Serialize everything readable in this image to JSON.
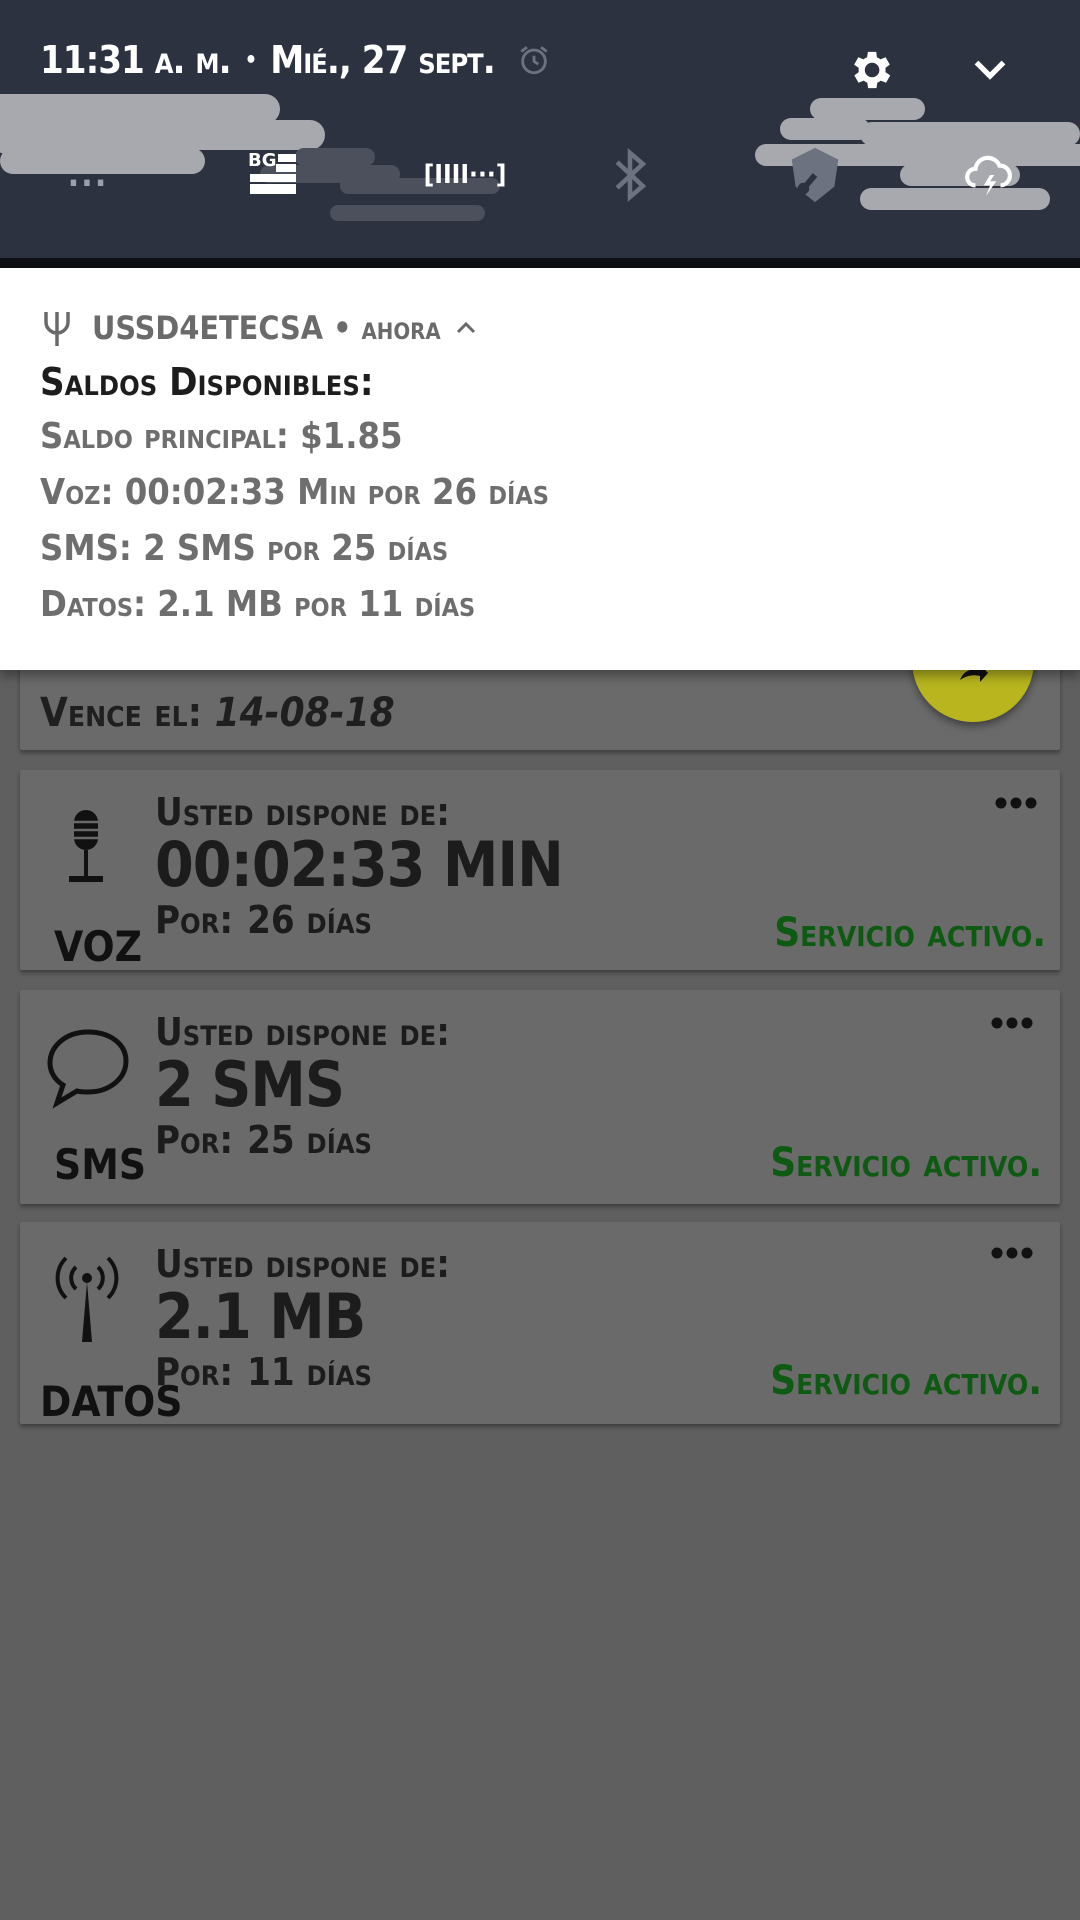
{
  "status_bar": {
    "time": "11:31 a. m.",
    "separator": "•",
    "date": "Mié., 27 sept."
  },
  "quick_tiles": {
    "overflow": "...",
    "battery_tile": "[IIII···]"
  },
  "notification": {
    "app_name": "USSD4ETECSA",
    "separator": "•",
    "time": "ahora",
    "title": "Saldos Disponibles:",
    "lines": [
      "Saldo principal: $1.85",
      "Voz: 00:02:33 Min por 26 días",
      "SMS: 2 SMS por 25 días",
      "Datos: 2.1 MB por 11 días"
    ]
  },
  "balance_card": {
    "expiry_label": "Vence el:",
    "expiry_date": "14-08-18"
  },
  "services": [
    {
      "name": "VOZ",
      "icon": "microphone-icon",
      "caption": "Usted dispone de:",
      "amount": "00:02:33 MIN",
      "period_label": "Por:",
      "period_value": "26 días",
      "status": "Servicio activo."
    },
    {
      "name": "SMS",
      "icon": "speech-bubble-icon",
      "caption": "Usted dispone de:",
      "amount": "2 SMS",
      "period_label": "Por:",
      "period_value": "25 días",
      "status": "Servicio activo."
    },
    {
      "name": "DATOS",
      "icon": "antenna-icon",
      "caption": "Usted dispone de:",
      "amount": "2.1 MB",
      "period_label": "Por:",
      "period_value": "11 días",
      "status": "Servicio activo."
    }
  ],
  "colors": {
    "shade_bg": "#2d3240",
    "content_bg": "#5f5f5f",
    "card_bg": "#6a6a6a",
    "status_active": "#0e5a13",
    "fab": "#b8b51f"
  }
}
